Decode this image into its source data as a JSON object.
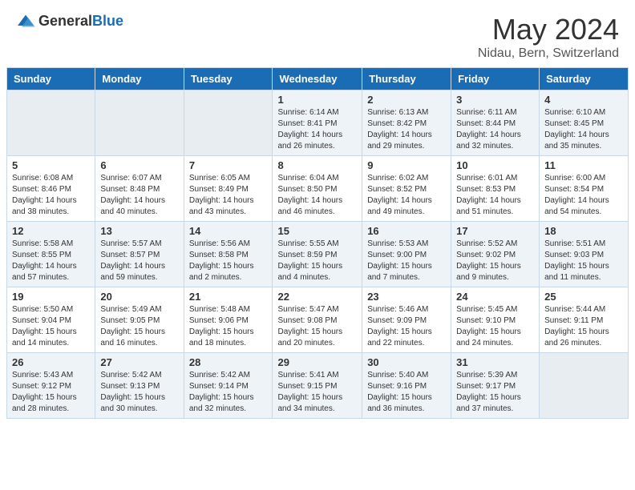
{
  "header": {
    "logo_general": "General",
    "logo_blue": "Blue",
    "month_title": "May 2024",
    "location": "Nidau, Bern, Switzerland"
  },
  "days_of_week": [
    "Sunday",
    "Monday",
    "Tuesday",
    "Wednesday",
    "Thursday",
    "Friday",
    "Saturday"
  ],
  "weeks": [
    [
      {
        "day": "",
        "info": ""
      },
      {
        "day": "",
        "info": ""
      },
      {
        "day": "",
        "info": ""
      },
      {
        "day": "1",
        "info": "Sunrise: 6:14 AM\nSunset: 8:41 PM\nDaylight: 14 hours\nand 26 minutes."
      },
      {
        "day": "2",
        "info": "Sunrise: 6:13 AM\nSunset: 8:42 PM\nDaylight: 14 hours\nand 29 minutes."
      },
      {
        "day": "3",
        "info": "Sunrise: 6:11 AM\nSunset: 8:44 PM\nDaylight: 14 hours\nand 32 minutes."
      },
      {
        "day": "4",
        "info": "Sunrise: 6:10 AM\nSunset: 8:45 PM\nDaylight: 14 hours\nand 35 minutes."
      }
    ],
    [
      {
        "day": "5",
        "info": "Sunrise: 6:08 AM\nSunset: 8:46 PM\nDaylight: 14 hours\nand 38 minutes."
      },
      {
        "day": "6",
        "info": "Sunrise: 6:07 AM\nSunset: 8:48 PM\nDaylight: 14 hours\nand 40 minutes."
      },
      {
        "day": "7",
        "info": "Sunrise: 6:05 AM\nSunset: 8:49 PM\nDaylight: 14 hours\nand 43 minutes."
      },
      {
        "day": "8",
        "info": "Sunrise: 6:04 AM\nSunset: 8:50 PM\nDaylight: 14 hours\nand 46 minutes."
      },
      {
        "day": "9",
        "info": "Sunrise: 6:02 AM\nSunset: 8:52 PM\nDaylight: 14 hours\nand 49 minutes."
      },
      {
        "day": "10",
        "info": "Sunrise: 6:01 AM\nSunset: 8:53 PM\nDaylight: 14 hours\nand 51 minutes."
      },
      {
        "day": "11",
        "info": "Sunrise: 6:00 AM\nSunset: 8:54 PM\nDaylight: 14 hours\nand 54 minutes."
      }
    ],
    [
      {
        "day": "12",
        "info": "Sunrise: 5:58 AM\nSunset: 8:55 PM\nDaylight: 14 hours\nand 57 minutes."
      },
      {
        "day": "13",
        "info": "Sunrise: 5:57 AM\nSunset: 8:57 PM\nDaylight: 14 hours\nand 59 minutes."
      },
      {
        "day": "14",
        "info": "Sunrise: 5:56 AM\nSunset: 8:58 PM\nDaylight: 15 hours\nand 2 minutes."
      },
      {
        "day": "15",
        "info": "Sunrise: 5:55 AM\nSunset: 8:59 PM\nDaylight: 15 hours\nand 4 minutes."
      },
      {
        "day": "16",
        "info": "Sunrise: 5:53 AM\nSunset: 9:00 PM\nDaylight: 15 hours\nand 7 minutes."
      },
      {
        "day": "17",
        "info": "Sunrise: 5:52 AM\nSunset: 9:02 PM\nDaylight: 15 hours\nand 9 minutes."
      },
      {
        "day": "18",
        "info": "Sunrise: 5:51 AM\nSunset: 9:03 PM\nDaylight: 15 hours\nand 11 minutes."
      }
    ],
    [
      {
        "day": "19",
        "info": "Sunrise: 5:50 AM\nSunset: 9:04 PM\nDaylight: 15 hours\nand 14 minutes."
      },
      {
        "day": "20",
        "info": "Sunrise: 5:49 AM\nSunset: 9:05 PM\nDaylight: 15 hours\nand 16 minutes."
      },
      {
        "day": "21",
        "info": "Sunrise: 5:48 AM\nSunset: 9:06 PM\nDaylight: 15 hours\nand 18 minutes."
      },
      {
        "day": "22",
        "info": "Sunrise: 5:47 AM\nSunset: 9:08 PM\nDaylight: 15 hours\nand 20 minutes."
      },
      {
        "day": "23",
        "info": "Sunrise: 5:46 AM\nSunset: 9:09 PM\nDaylight: 15 hours\nand 22 minutes."
      },
      {
        "day": "24",
        "info": "Sunrise: 5:45 AM\nSunset: 9:10 PM\nDaylight: 15 hours\nand 24 minutes."
      },
      {
        "day": "25",
        "info": "Sunrise: 5:44 AM\nSunset: 9:11 PM\nDaylight: 15 hours\nand 26 minutes."
      }
    ],
    [
      {
        "day": "26",
        "info": "Sunrise: 5:43 AM\nSunset: 9:12 PM\nDaylight: 15 hours\nand 28 minutes."
      },
      {
        "day": "27",
        "info": "Sunrise: 5:42 AM\nSunset: 9:13 PM\nDaylight: 15 hours\nand 30 minutes."
      },
      {
        "day": "28",
        "info": "Sunrise: 5:42 AM\nSunset: 9:14 PM\nDaylight: 15 hours\nand 32 minutes."
      },
      {
        "day": "29",
        "info": "Sunrise: 5:41 AM\nSunset: 9:15 PM\nDaylight: 15 hours\nand 34 minutes."
      },
      {
        "day": "30",
        "info": "Sunrise: 5:40 AM\nSunset: 9:16 PM\nDaylight: 15 hours\nand 36 minutes."
      },
      {
        "day": "31",
        "info": "Sunrise: 5:39 AM\nSunset: 9:17 PM\nDaylight: 15 hours\nand 37 minutes."
      },
      {
        "day": "",
        "info": ""
      }
    ]
  ]
}
